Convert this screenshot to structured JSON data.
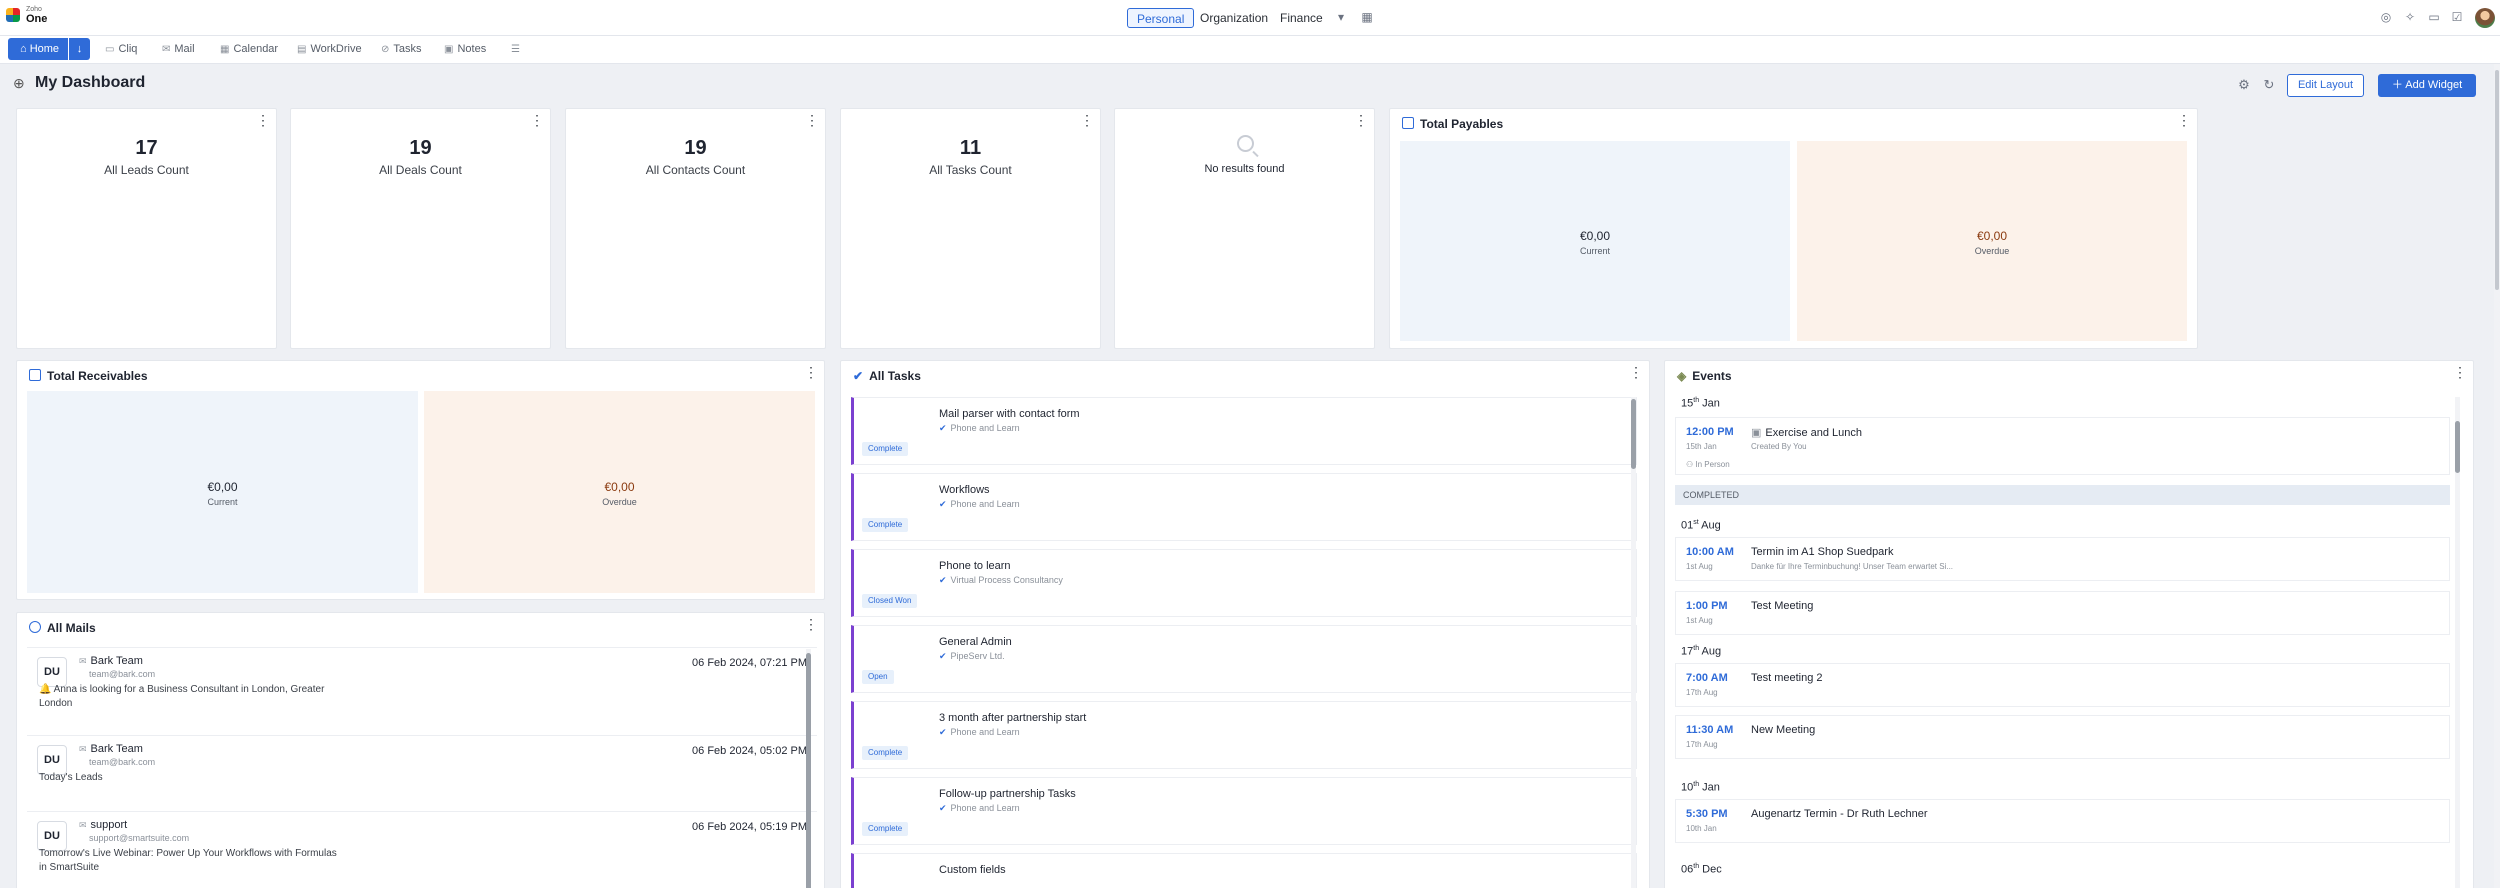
{
  "app": {
    "brand_top": "Zoho",
    "brand_name": "One"
  },
  "topbar": {
    "segments": [
      "Personal",
      "Organization",
      "Finance"
    ],
    "icons": [
      "dropdown-icon",
      "grid-icon",
      "bell-icon",
      "gear-icon",
      "calendar-icon",
      "checklist-icon"
    ]
  },
  "nav": {
    "home": "Home",
    "apps": [
      "Cliq",
      "Mail",
      "Calendar",
      "WorkDrive",
      "Tasks",
      "Notes"
    ]
  },
  "dashboard": {
    "title": "My Dashboard",
    "edit_layout": "Edit Layout",
    "add_widget": "Add Widget"
  },
  "counts": [
    {
      "value": "17",
      "label": "All Leads Count"
    },
    {
      "value": "19",
      "label": "All Deals Count"
    },
    {
      "value": "19",
      "label": "All Contacts Count"
    },
    {
      "value": "11",
      "label": "All Tasks Count"
    }
  ],
  "no_results": "No results found",
  "payables": {
    "title": "Total Payables",
    "current_amount": "€0,00",
    "current_label": "Current",
    "overdue_amount": "€0,00",
    "overdue_label": "Overdue"
  },
  "receivables": {
    "title": "Total Receivables",
    "current_amount": "€0,00",
    "current_label": "Current",
    "overdue_amount": "€0,00",
    "overdue_label": "Overdue"
  },
  "mails": {
    "title": "All Mails",
    "items": [
      {
        "initials": "DU",
        "from": "Bark Team",
        "email": "team@bark.com",
        "date": "06 Feb 2024, 07:21 PM",
        "subject": "🔔 Anna is looking for a Business Consultant in London, Greater London"
      },
      {
        "initials": "DU",
        "from": "Bark Team",
        "email": "team@bark.com",
        "date": "06 Feb 2024, 05:02 PM",
        "subject": "Today's Leads"
      },
      {
        "initials": "DU",
        "from": "support",
        "email": "support@smartsuite.com",
        "date": "06 Feb 2024, 05:19 PM",
        "subject": "Tomorrow's Live Webinar: Power Up Your Workflows with Formulas in SmartSuite"
      }
    ]
  },
  "tasks": {
    "title": "All Tasks",
    "items": [
      {
        "title": "Mail parser with contact form",
        "related": "Phone and Learn",
        "status": "Complete"
      },
      {
        "title": "Workflows",
        "related": "Phone and Learn",
        "status": "Complete"
      },
      {
        "title": "Phone to learn",
        "related": "Virtual Process Consultancy",
        "status": "Closed Won"
      },
      {
        "title": "General Admin",
        "related": "PipeServ Ltd.",
        "status": "Open"
      },
      {
        "title": "3 month after partnership start",
        "related": "Phone and Learn",
        "status": "Complete"
      },
      {
        "title": "Follow-up partnership Tasks",
        "related": "Phone and Learn",
        "status": "Complete"
      },
      {
        "title": "Custom fields",
        "related": "",
        "status": ""
      }
    ]
  },
  "events": {
    "title": "Events",
    "groups": [
      {
        "day": "15",
        "sup": "th",
        "month": "Jan"
      },
      {
        "day": "01",
        "sup": "st",
        "month": "Aug"
      },
      {
        "day": "17",
        "sup": "th",
        "month": "Aug"
      },
      {
        "day": "10",
        "sup": "th",
        "month": "Jan"
      },
      {
        "day": "06",
        "sup": "th",
        "month": "Dec"
      }
    ],
    "items": [
      {
        "time": "12:00 PM",
        "date": "15th Jan",
        "title": "Exercise and Lunch",
        "desc": "Created By You",
        "extra": "In Person"
      },
      {
        "time": "10:00 AM",
        "date": "1st Aug",
        "title": "Termin im A1 Shop Suedpark",
        "desc": "Danke für Ihre Terminbuchung! Unser Team erwartet Si..."
      },
      {
        "time": "1:00 PM",
        "date": "1st Aug",
        "title": "Test Meeting",
        "desc": ""
      },
      {
        "time": "7:00 AM",
        "date": "17th Aug",
        "title": "Test meeting 2",
        "desc": ""
      },
      {
        "time": "11:30 AM",
        "date": "17th Aug",
        "title": "New Meeting",
        "desc": ""
      },
      {
        "time": "5:30 PM",
        "date": "10th Jan",
        "title": "Augenartz Termin - Dr Ruth Lechner",
        "desc": ""
      }
    ],
    "completed_label": "COMPLETED"
  }
}
